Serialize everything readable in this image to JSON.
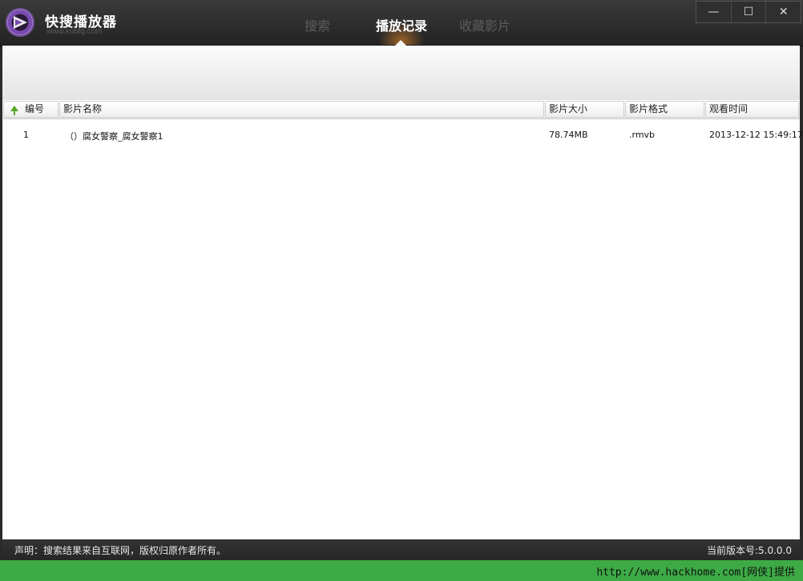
{
  "app": {
    "title": "快搜播放器",
    "url": "www.ksbfq.com"
  },
  "tabs": [
    {
      "label": "搜索",
      "active": false
    },
    {
      "label": "播放记录",
      "active": true
    },
    {
      "label": "收藏影片",
      "active": false
    }
  ],
  "window_buttons": {
    "minimize": "—",
    "maximize": "☐",
    "close": "✕"
  },
  "table": {
    "columns": [
      "编号",
      "影片名称",
      "影片大小",
      "影片格式",
      "观看时间"
    ],
    "rows": [
      {
        "num": "1",
        "name": "（）腐女警察_腐女警察1",
        "size": "78.74MB",
        "format": ".rmvb",
        "time": "2013-12-12 15:49:17"
      }
    ]
  },
  "footer": {
    "disclaimer": "声明：搜索结果来自互联网，版权归原作者所有。",
    "version": "当前版本号:5.0.0.0"
  },
  "credit": "http://www.hackhome.com[网侠]提供",
  "colors": {
    "titlebar": "#262626",
    "accent_glow": "#ff9628",
    "sort_arrow": "#5aa82a",
    "credit_bar": "#3daa45"
  }
}
